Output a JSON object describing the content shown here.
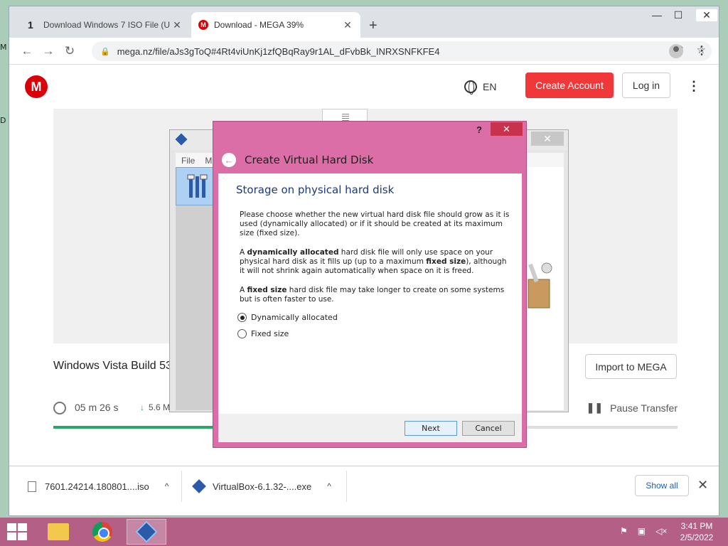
{
  "desktop": {
    "edge_top": "M",
    "edge_mid": "D"
  },
  "browser": {
    "tabs": [
      {
        "title": "Download Windows 7 ISO File (U",
        "close": "✕"
      },
      {
        "title": "Download - MEGA 39%",
        "close": "✕"
      }
    ],
    "new_tab": "+",
    "window_controls": {
      "minimize": "—",
      "maximize": "☐",
      "close": "✕"
    },
    "url": "mega.nz/file/aJs3gToQ#4Rt4viUnKj1zfQBqRay9r1AL_dFvbBk_INRXSNFKFE4"
  },
  "mega": {
    "logo": "M",
    "language": "EN",
    "create_account": "Create Account",
    "login": "Log in",
    "file_name": "Windows Vista Build 53",
    "import_button": "Import to MEGA",
    "time_remaining": "05 m 26 s",
    "speed": "5.6 M",
    "pause_label": "Pause Transfer",
    "progress_percent": 39
  },
  "vbox_window": {
    "menu": [
      "File",
      "M"
    ]
  },
  "dialog": {
    "help": "?",
    "close": "✕",
    "title": "Create Virtual Hard Disk",
    "heading": "Storage on physical hard disk",
    "para1": "Please choose whether the new virtual hard disk file should grow as it is used (dynamically allocated) or if it should be created at its maximum size (fixed size).",
    "para2_a": "A ",
    "para2_b": "dynamically allocated",
    "para2_c": " hard disk file will only use space on your physical hard disk as it fills up (up to a maximum ",
    "para2_d": "fixed size",
    "para2_e": "), although it will not shrink again automatically when space on it is freed.",
    "para3_a": "A ",
    "para3_b": "fixed size",
    "para3_c": " hard disk file may take longer to create on some systems but is often faster to use.",
    "options": [
      {
        "label": "Dynamically allocated",
        "checked": true
      },
      {
        "label": "Fixed size",
        "checked": false
      }
    ],
    "next": "Next",
    "cancel": "Cancel"
  },
  "downloads": [
    {
      "name": "7601.24214.180801....iso"
    },
    {
      "name": "VirtualBox-6.1.32-....exe"
    }
  ],
  "downloads_show_all": "Show all",
  "taskbar": {
    "time": "3:41 PM",
    "date": "2/5/2022"
  },
  "colors": {
    "dialog_frame": "#db6ea6",
    "taskbar": "#b35f86",
    "mega_red": "#f0373a",
    "progress": "#2ba66b"
  }
}
